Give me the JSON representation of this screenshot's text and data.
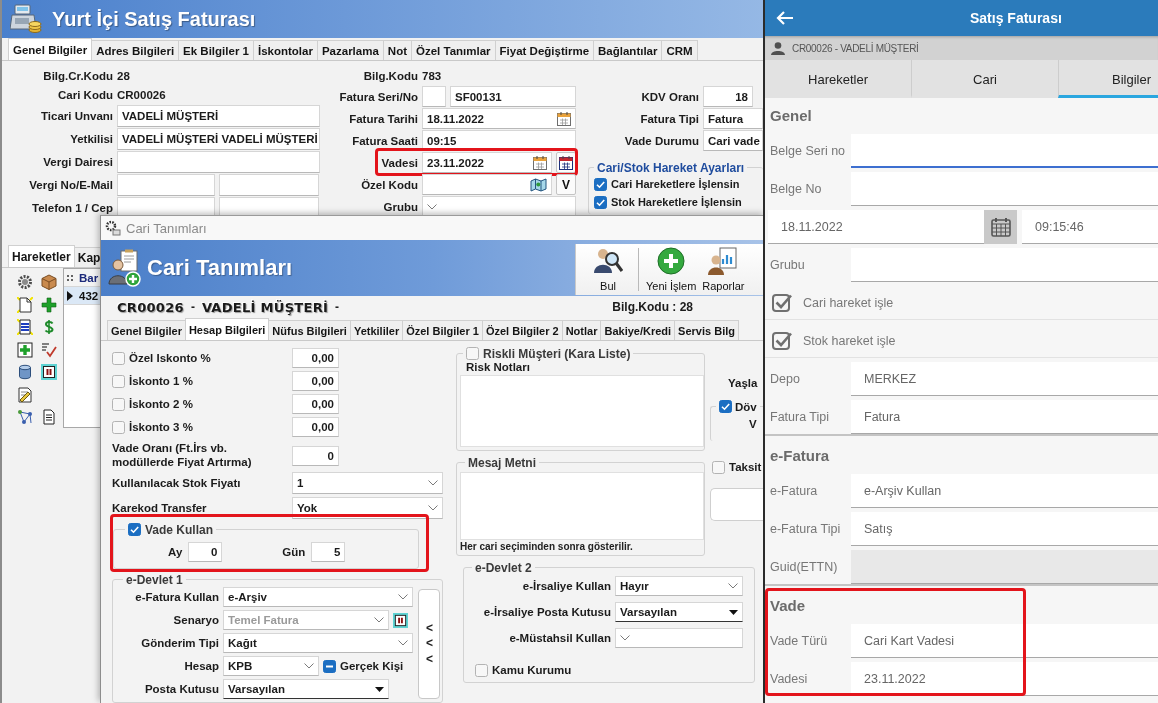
{
  "main_window": {
    "title": "Yurt İçi Satış Faturası",
    "tabs": [
      {
        "label": "Genel Bilgiler",
        "selected": true
      },
      {
        "label": "Adres Bilgileri",
        "selected": false
      },
      {
        "label": "Ek Bilgiler 1",
        "selected": false
      },
      {
        "label": "İskontolar",
        "selected": false
      },
      {
        "label": "Pazarlama",
        "selected": false
      },
      {
        "label": "Not",
        "selected": false
      },
      {
        "label": "Özel Tanımlar",
        "selected": false
      },
      {
        "label": "Fiyat Değiştirme",
        "selected": false
      },
      {
        "label": "Bağlantılar",
        "selected": false
      },
      {
        "label": "CRM",
        "selected": false
      }
    ],
    "left_fields": [
      {
        "kind": "text",
        "label": "Bilg.Cr.Kodu",
        "value": "28"
      },
      {
        "kind": "text",
        "label": "Cari Kodu",
        "value": "CR00026"
      },
      {
        "kind": "input",
        "label": "Ticari Unvanı",
        "value": "VADELİ MÜŞTERİ"
      },
      {
        "kind": "input",
        "label": "Yetkilisi",
        "value": "VADELİ MÜŞTERİ VADELİ MÜŞTERİ"
      },
      {
        "kind": "input",
        "label": "Vergi Dairesi"
      },
      {
        "kind": "pair",
        "label": "Vergi No/E-Mail"
      },
      {
        "kind": "pair",
        "label": "Telefon 1 / Cep"
      }
    ],
    "middle_fields": [
      {
        "kind": "text",
        "label": "Bilg.Kodu",
        "value": "783",
        "highlighted": false
      },
      {
        "kind": "serial",
        "label": "Fatura Seri/No",
        "value": "SF00131",
        "highlighted": false
      },
      {
        "kind": "date",
        "label": "Fatura Tarihi",
        "value": "18.11.2022",
        "highlighted": false
      },
      {
        "kind": "input",
        "label": "Fatura Saati",
        "value": "09:15",
        "highlighted": false
      },
      {
        "kind": "date_picker",
        "label": "Vadesi",
        "value": "23.11.2022",
        "highlighted": true
      },
      {
        "kind": "lookup",
        "label": "Özel Kodu",
        "button": "V",
        "highlighted": false
      },
      {
        "kind": "combo",
        "label": "Grubu",
        "highlighted": false
      }
    ],
    "right_fields": [
      {
        "kind": "number",
        "label": "KDV Oranı",
        "value": "18"
      },
      {
        "kind": "input",
        "label": "Fatura Tipi",
        "value": "Fatura"
      },
      {
        "kind": "input",
        "label": "Vade Durumu",
        "value": "Cari vade"
      }
    ],
    "movement_settings": {
      "title": "Cari/Stok Hareket Ayarları",
      "options": [
        {
          "label": "Cari Hareketlere İşlensin",
          "checked": true
        },
        {
          "label": "Stok Hareketlere İşlensin",
          "checked": true
        }
      ]
    },
    "bottom_tabs": [
      {
        "label": "Hareketler",
        "selected": true
      },
      {
        "label": "Kap",
        "selected": false
      }
    ],
    "grid": {
      "columns": [
        "Bar"
      ],
      "rows": [
        {
          "cells": [
            "432"
          ],
          "selected": true
        }
      ]
    }
  },
  "dialog": {
    "title": "Cari Tanımları",
    "header_title": "Cari Tanımları",
    "toolbar": [
      {
        "kind": "search",
        "label": "Bul"
      },
      {
        "kind": "add",
        "label": "Yeni İşlem"
      },
      {
        "kind": "report",
        "label": "Raporlar"
      }
    ],
    "account": [
      {
        "kind": "embossed",
        "text": "CR00026"
      },
      {
        "kind": "plain",
        "text": "-"
      },
      {
        "kind": "embossed",
        "text": "VADELİ MÜŞTERİ"
      },
      {
        "kind": "plain",
        "text": "-"
      }
    ],
    "code_info": "Bilg.Kodu : 28",
    "tabs": [
      {
        "label": "Genel Bilgiler",
        "selected": false
      },
      {
        "label": "Hesap Bilgileri",
        "selected": true
      },
      {
        "label": "Nüfus Bilgileri",
        "selected": false
      },
      {
        "label": "Yetkililer",
        "selected": false
      },
      {
        "label": "Özel Bilgiler 1",
        "selected": false
      },
      {
        "label": "Özel Bilgiler 2",
        "selected": false
      },
      {
        "label": "Notlar",
        "selected": false
      },
      {
        "label": "Bakiye/Kredi",
        "selected": false
      },
      {
        "label": "Servis Bilg",
        "selected": false
      }
    ],
    "discounts": [
      {
        "label": "Özel Iskonto %",
        "checked": false,
        "value": "0,00"
      },
      {
        "label": "İskonto 1 %",
        "checked": false,
        "value": "0,00"
      },
      {
        "label": "İskonto 2 %",
        "checked": false,
        "value": "0,00"
      },
      {
        "label": "İskonto 3 %",
        "checked": false,
        "value": "0,00"
      }
    ],
    "term_rate": {
      "label": "Vade Oranı (Ft.İrs vb. modüllerde Fiyat Artırma)",
      "value": "0"
    },
    "combos": [
      {
        "label": "Kullanılacak Stok Fiyatı",
        "value": "1"
      },
      {
        "label": "Karekod Transfer",
        "value": "Yok"
      }
    ],
    "use_term": {
      "label": "Vade Kullan",
      "checked": true,
      "highlighted": true,
      "fields": [
        {
          "label": "Ay",
          "value": "0"
        },
        {
          "label": "Gün",
          "value": "5"
        }
      ]
    },
    "e_state_1": {
      "title": "e-Devlet 1",
      "side_button": "<<<",
      "rows": [
        {
          "kind": "combo",
          "label": "e-Fatura Kullan",
          "value": "e-Arşiv",
          "disabled": false
        },
        {
          "kind": "combo_button",
          "label": "Senaryo",
          "value": "Temel Fatura",
          "disabled": true
        },
        {
          "kind": "combo",
          "label": "Gönderim Tipi",
          "value": "Kağıt",
          "disabled": false
        },
        {
          "kind": "combo_check",
          "label": "Hesap",
          "value": "KPB",
          "disabled": false,
          "check": {
            "label": "Gerçek Kişi",
            "indeterminate": true
          }
        },
        {
          "kind": "dropdown",
          "label": "Posta Kutusu",
          "value": "Varsayılan",
          "disabled": false
        }
      ]
    },
    "risk": {
      "label": "Riskli Müşteri (Kara Liste)",
      "checked": false,
      "notes_label": "Risk Notları"
    },
    "message": {
      "title": "Mesaj Metni",
      "hint": "Her cari seçiminden sonra gösterilir."
    },
    "e_state_2": {
      "title": "e-Devlet 2",
      "rows": [
        {
          "kind": "combo",
          "label": "e-İrsaliye Kullan",
          "value": "Hayır"
        },
        {
          "kind": "dropdown",
          "label": "e-İrsaliye Posta Kutusu",
          "value": "Varsayılan"
        },
        {
          "kind": "combo",
          "label": "e-Müstahsil Kullan"
        }
      ],
      "public_body": {
        "label": "Kamu Kurumu",
        "checked": false
      }
    },
    "aging": {
      "label": "Yaşla",
      "currency": {
        "label": "Döv",
        "checked": true
      },
      "group_text": "V",
      "installment": {
        "label": "Taksit",
        "checked": false
      }
    }
  },
  "mobile": {
    "title": "Satış Faturası",
    "customer": "CR00026 - VADELİ MÜŞTERİ",
    "tabs": [
      {
        "label": "Hareketler",
        "selected": false
      },
      {
        "label": "Cari",
        "selected": false
      },
      {
        "label": "Bilgiler",
        "selected": true
      }
    ],
    "sections": [
      {
        "title": "Genel",
        "highlighted": false,
        "rows": [
          {
            "kind": "field",
            "label": "Belge Seri no",
            "focused": true,
            "disabled": false
          },
          {
            "kind": "field",
            "label": "Belge No",
            "focused": false,
            "disabled": false
          },
          {
            "kind": "datetime",
            "date": "18.11.2022",
            "time": "09:15:46"
          },
          {
            "kind": "field",
            "label": "Grubu",
            "focused": false,
            "disabled": false
          },
          {
            "kind": "checkbox",
            "label": "Cari hareket işle",
            "checked": true
          },
          {
            "kind": "checkbox",
            "label": "Stok hareket işle",
            "checked": true
          },
          {
            "kind": "field",
            "label": "Depo",
            "value": "MERKEZ",
            "focused": false,
            "disabled": false
          },
          {
            "kind": "field",
            "label": "Fatura Tipi",
            "value": "Fatura",
            "focused": false,
            "disabled": false
          }
        ]
      },
      {
        "title": "e-Fatura",
        "highlighted": false,
        "rows": [
          {
            "kind": "field",
            "label": "e-Fatura",
            "value": "e-Arşiv Kullan",
            "focused": false,
            "disabled": false
          },
          {
            "kind": "field",
            "label": "e-Fatura Tipi",
            "value": "Satış",
            "focused": false,
            "disabled": false
          },
          {
            "kind": "field",
            "label": "Guid(ETTN)",
            "focused": false,
            "disabled": true
          }
        ]
      },
      {
        "title": "Vade",
        "highlighted": true,
        "rows": [
          {
            "kind": "field",
            "label": "Vade Türü",
            "value": "Cari Kart Vadesi",
            "focused": false,
            "disabled": false
          },
          {
            "kind": "field",
            "label": "Vadesi",
            "value": "23.11.2022",
            "focused": false,
            "disabled": false
          }
        ]
      }
    ]
  }
}
